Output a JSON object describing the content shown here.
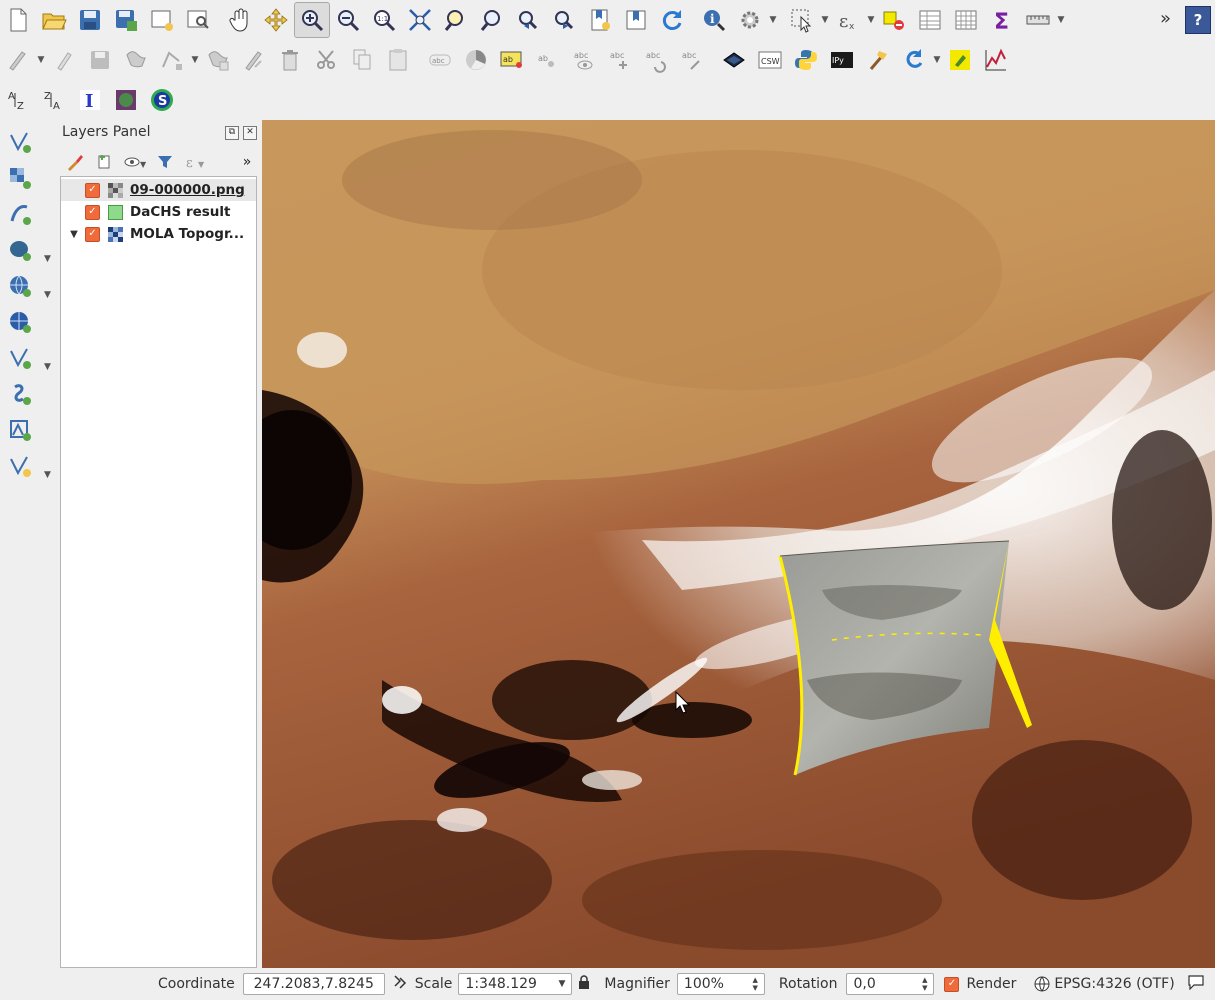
{
  "toolbar": {
    "row1": [
      "new-project",
      "open-project",
      "save-project",
      "save-as",
      "new-print-layout",
      "layout-manager",
      "pan",
      "pan-to-selection",
      "zoom-in",
      "zoom-out",
      "zoom-native",
      "zoom-full",
      "zoom-selection",
      "zoom-layer",
      "zoom-last",
      "zoom-next",
      "new-bookmark",
      "show-bookmarks",
      "refresh",
      "identify",
      "action",
      "select",
      "measure-area",
      "deselect",
      "attribute-table",
      "field-calculator",
      "statistics",
      "measure-line"
    ],
    "more_label": "»",
    "help_label": "?"
  },
  "layers_panel": {
    "title": "Layers Panel",
    "more_label": "»",
    "layers": [
      {
        "name": "09-000000.png",
        "checked": true,
        "selected": true,
        "underlined": true,
        "icon": "raster-layer-icon"
      },
      {
        "name": "DaCHS result",
        "checked": true,
        "selected": false,
        "underlined": false,
        "icon": "polygon-layer-icon"
      },
      {
        "name": "MOLA Topogr...",
        "checked": true,
        "selected": false,
        "underlined": false,
        "icon": "raster-layer-icon",
        "expander": "▼"
      }
    ]
  },
  "status": {
    "coordinate_label": "Coordinate",
    "coordinate_value": "247.2083,7.8245",
    "scale_label": "Scale",
    "scale_value": "1:348.129",
    "magnifier_label": "Magnifier",
    "magnifier_value": "100%",
    "rotation_label": "Rotation",
    "rotation_value": "0,0",
    "render_label": "Render",
    "render_checked": true,
    "crs_label": "EPSG:4326 (OTF)"
  },
  "colors": {
    "footprint_outline": "#ffee00",
    "checkbox": "#f06a3a"
  }
}
